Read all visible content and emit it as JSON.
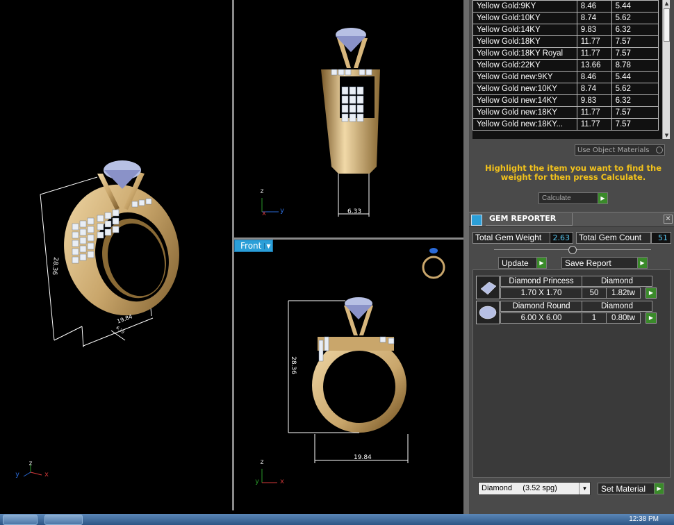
{
  "viewports": {
    "perspective": {
      "dimensions": [
        "28.36",
        "19.84",
        "6.33"
      ],
      "axes": {
        "z": "z",
        "y": "y",
        "x": "x"
      }
    },
    "top_right": {
      "dimension": "6.33",
      "axes": {
        "z": "z",
        "x": "x",
        "y": "y"
      }
    },
    "front": {
      "view_label": "Front",
      "dimensions": [
        "28.36",
        "19.84"
      ],
      "axes": {
        "z": "z",
        "y": "y",
        "x": "x"
      }
    }
  },
  "weight_table": {
    "rows": [
      [
        "Yellow Gold:9KY",
        "8.46",
        "5.44"
      ],
      [
        "Yellow Gold:10KY",
        "8.74",
        "5.62"
      ],
      [
        "Yellow Gold:14KY",
        "9.83",
        "6.32"
      ],
      [
        "Yellow Gold:18KY",
        "11.77",
        "7.57"
      ],
      [
        "Yellow Gold:18KY Royal",
        "11.77",
        "7.57"
      ],
      [
        "Yellow Gold:22KY",
        "13.66",
        "8.78"
      ],
      [
        "Yellow Gold new:9KY",
        "8.46",
        "5.44"
      ],
      [
        "Yellow Gold new:10KY",
        "8.74",
        "5.62"
      ],
      [
        "Yellow Gold new:14KY",
        "9.83",
        "6.32"
      ],
      [
        "Yellow Gold new:18KY",
        "11.77",
        "7.57"
      ],
      [
        "Yellow Gold new:18KY...",
        "11.77",
        "7.57"
      ]
    ],
    "use_object_materials": "Use Object Materials"
  },
  "hint": "Highlight the item you want to find the weight for then press Calculate.",
  "calculate_label": "Calculate",
  "gem_reporter": {
    "title": "GEM REPORTER",
    "total_weight_label": "Total Gem Weight",
    "total_weight": "2.63",
    "total_count_label": "Total Gem Count",
    "total_count": "51",
    "update_label": "Update",
    "save_report_label": "Save Report",
    "gems": [
      {
        "name": "Diamond Princess",
        "material": "Diamond",
        "size": "1.70 X 1.70",
        "count": "50",
        "weight": "1.82tw"
      },
      {
        "name": "Diamond Round",
        "material": "Diamond",
        "size": "6.00 X 6.00",
        "count": "1",
        "weight": "0.80tw"
      }
    ],
    "material_select": "Diamond     (3.52 spg)",
    "set_material_label": "Set Material"
  },
  "taskbar": {
    "clock": "12:38 PM"
  },
  "colors": {
    "gold": "#c9a66b",
    "accent_blue": "#2b9fd8",
    "hint_yellow": "#f2c21b",
    "go_green": "#3a8a2a"
  }
}
